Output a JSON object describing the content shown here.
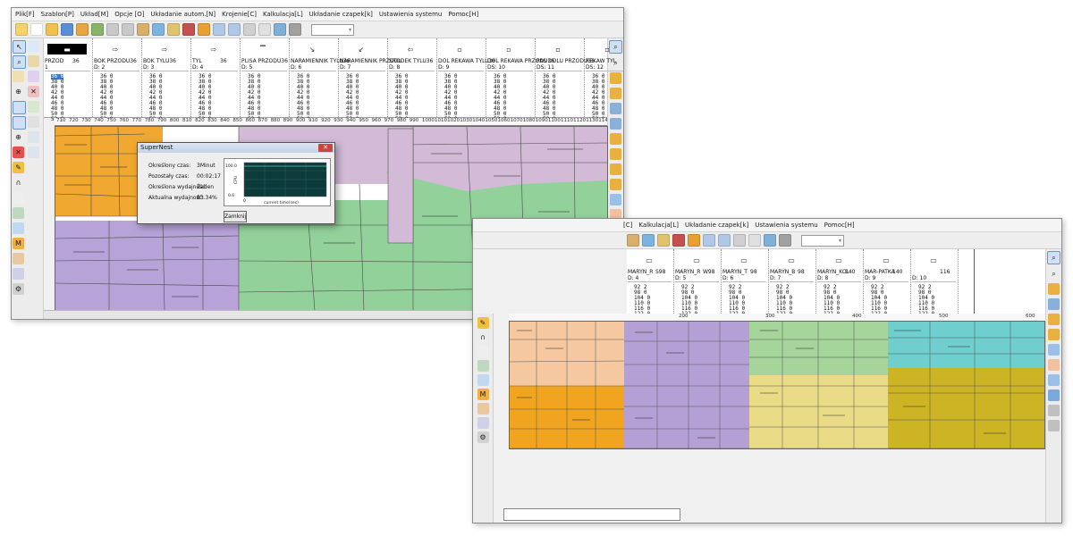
{
  "window1": {
    "menu": [
      "Plik[F]",
      "Szablon[P]",
      "Układ[M]",
      "Opcje [O]",
      "Układanie autom.[N]",
      "Krojenie[C]",
      "Kalkulacja[L]",
      "Układanie czapek[k]",
      "Ustawienia systemu",
      "Pomoc[H]"
    ],
    "pieces": [
      {
        "name": "PRZOD",
        "size": "36",
        "num": "1",
        "shape": "▬"
      },
      {
        "name": "BOK PRZODU36",
        "size": "",
        "num": "D:  2",
        "shape": "⇨"
      },
      {
        "name": "BOK TYLU36",
        "size": "",
        "num": "D:  3",
        "shape": "⇨"
      },
      {
        "name": "TYL",
        "size": "36",
        "num": "D:  4",
        "shape": "⇨"
      },
      {
        "name": "PLISA PRZODU36",
        "size": "",
        "num": "D:  5",
        "shape": "▔"
      },
      {
        "name": "NARAMIENNIK TYLU36",
        "size": "",
        "num": "D:  6",
        "shape": "↘"
      },
      {
        "name": "NARAMIENNIK PRZODU",
        "size": "",
        "num": "D:  7",
        "shape": "↙"
      },
      {
        "name": "SRODEK TYLU36",
        "size": "",
        "num": "D:  8",
        "shape": "⇦"
      },
      {
        "name": "DOL REKAWA TYLU36",
        "size": "",
        "num": "D:  9",
        "shape": "▫"
      },
      {
        "name": "DOL REKAWA PRZODU36",
        "size": "",
        "num": "DS: 10",
        "shape": "▫"
      },
      {
        "name": "PAS DOLU PRZODU36",
        "size": "",
        "num": "DS: 11",
        "shape": "▫"
      },
      {
        "name": "REKAW TYL",
        "size": "",
        "num": "DS: 12",
        "shape": "▫"
      }
    ],
    "size_rows": [
      "36 0",
      "38 0",
      "40 0",
      "42 0",
      "44 0",
      "46 0",
      "48 0",
      "50 0",
      "52 0"
    ],
    "ruler_ticks": [
      "710",
      "720",
      "730",
      "740",
      "750",
      "760",
      "770",
      "780",
      "790",
      "800",
      "810",
      "820",
      "830",
      "840",
      "850",
      "860",
      "870",
      "880",
      "890",
      "900",
      "910",
      "920",
      "930",
      "940",
      "950",
      "960",
      "970",
      "980",
      "990",
      "1000",
      "1010",
      "1020",
      "1030",
      "1040",
      "1050",
      "1060",
      "1070",
      "1080",
      "1090",
      "1100",
      "1110",
      "1120",
      "1130",
      "1140"
    ],
    "colors": {
      "orange": "#f0a830",
      "purple": "#b7a3d8",
      "green": "#93d19b",
      "lilac": "#d3bbd8"
    }
  },
  "dialog": {
    "title": "SuperNest",
    "rows": [
      {
        "label": "Określony czas:",
        "value": "3Minut"
      },
      {
        "label": "Pozostały czas:",
        "value": "00:02:17"
      },
      {
        "label": "Określona wydajność:",
        "value": "Żaden"
      },
      {
        "label": "Aktualna wydajność:",
        "value": "83.34%"
      }
    ],
    "button": "Zamknij",
    "close_glyph": "✕",
    "chart": {
      "ylabel": "CPU",
      "y_max": "100.0",
      "y_min": "0.6",
      "x_start": "0",
      "x_label": "current time(sec)"
    }
  },
  "window2": {
    "menu": [
      "[C]",
      "Kalkulacja[L]",
      "Układanie czapek[k]",
      "Ustawienia systemu",
      "Pomoc[H]"
    ],
    "pieces": [
      {
        "name": "MARYN_R",
        "size": "S98",
        "num": "D:  4"
      },
      {
        "name": "MARYN_R",
        "size": "W98",
        "num": "D:  5"
      },
      {
        "name": "MARYN_T",
        "size": "98",
        "num": "D:  6"
      },
      {
        "name": "MARYN_B",
        "size": "98",
        "num": "D:  7"
      },
      {
        "name": "MARYN_KOL",
        "size": "140",
        "num": "D:  8"
      },
      {
        "name": "MAR-PATKA",
        "size": "140",
        "num": "D:  9"
      },
      {
        "name": "",
        "size": "116",
        "num": "D:  10"
      }
    ],
    "size_rows": [
      "92  2",
      "98  0",
      "104  0",
      "110  0",
      "116  0",
      "122  0",
      "128  0",
      "134  0",
      "140  0"
    ],
    "ruler_ticks": [
      "200",
      "300",
      "400",
      "500",
      "600"
    ],
    "colors": {
      "peach": "#f5c8a0",
      "orange": "#f0a420",
      "purple": "#b5a0d5",
      "green": "#a5d59a",
      "yellow": "#eadc86",
      "olive": "#ccb425",
      "teal": "#6fcfcf"
    }
  }
}
